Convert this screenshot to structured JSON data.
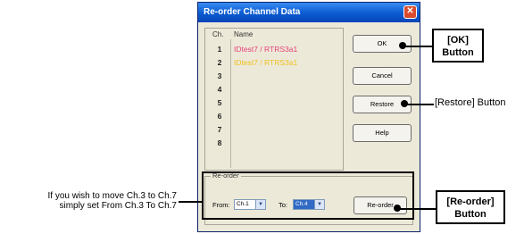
{
  "window": {
    "title": "Re-order Channel Data",
    "close_glyph": "✕"
  },
  "list": {
    "ch_header": "Ch.",
    "name_header": "Name",
    "channels": [
      "1",
      "2",
      "3",
      "4",
      "5",
      "6",
      "7",
      "8"
    ],
    "names": [
      {
        "text": "IDtest7  / RTRS3a1",
        "color": "#e8407a"
      },
      {
        "text": "IDtest7  / RTRS3a1",
        "color": "#f0c020"
      }
    ]
  },
  "buttons": {
    "ok": "OK",
    "cancel": "Cancel",
    "restore": "Restore",
    "help": "Help",
    "reorder": "Re-order"
  },
  "reorder_group": {
    "title": "Re-order",
    "from_label": "From:",
    "from_value": "Ch.1",
    "to_label": "To:",
    "to_value": "Ch.4"
  },
  "annotations": {
    "ok_line1": "[OK]",
    "ok_line2": "Button",
    "restore": "[Restore] Button",
    "reorder_line1": "[Re-order]",
    "reorder_line2": "Button",
    "hint_line1": "If you wish to move Ch.3 to Ch.7",
    "hint_line2": "simply set From Ch.3 To Ch.7"
  }
}
